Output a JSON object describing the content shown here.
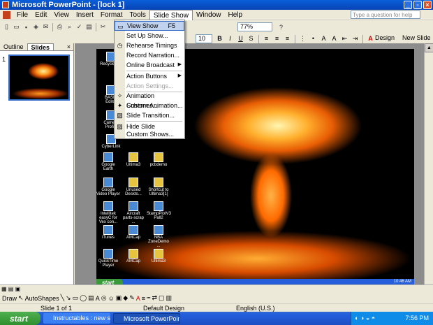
{
  "window": {
    "title": "Microsoft PowerPoint - [lock 1]"
  },
  "menubar": {
    "items": [
      "File",
      "Edit",
      "View",
      "Insert",
      "Format",
      "Tools",
      "Slide Show",
      "Window",
      "Help"
    ],
    "help_placeholder": "Type a question for help"
  },
  "toolbar": {
    "zoom": "77%",
    "font_size": "10",
    "design_label": "Design",
    "new_slide_label": "New Slide"
  },
  "slide_show_menu": {
    "items": [
      {
        "label": "View Show",
        "shortcut": "F5",
        "icon": "slideshow-icon",
        "state": "highlighted"
      },
      {
        "label": "Set Up Show...",
        "icon": "",
        "state": "normal"
      },
      {
        "label": "Rehearse Timings",
        "icon": "timer-icon",
        "state": "normal"
      },
      {
        "label": "Record Narration...",
        "icon": "",
        "state": "normal"
      },
      {
        "label": "Online Broadcast",
        "icon": "",
        "state": "submenu"
      },
      {
        "label": "Action Buttons",
        "icon": "",
        "state": "submenu"
      },
      {
        "label": "Action Settings...",
        "icon": "",
        "state": "disabled"
      },
      {
        "label": "Animation Schemes...",
        "icon": "animation-icon",
        "state": "normal"
      },
      {
        "label": "Custom Animation...",
        "icon": "custom-animation-icon",
        "state": "normal"
      },
      {
        "label": "Slide Transition...",
        "icon": "transition-icon",
        "state": "normal"
      },
      {
        "label": "Hide Slide",
        "icon": "hide-slide-icon",
        "state": "normal"
      },
      {
        "label": "Custom Shows...",
        "icon": "",
        "state": "normal"
      }
    ]
  },
  "left_pane": {
    "tabs": [
      "Outline",
      "Slides"
    ],
    "active_tab": "Slides",
    "slide_number": "1"
  },
  "slide_desktop_icons": [
    {
      "label": "Recycle Bin",
      "type": "app"
    },
    {
      "label": "BASIC Editor",
      "type": "app"
    },
    {
      "label": "Camera Profile",
      "type": "app"
    },
    {
      "label": "CyberLink",
      "type": "app"
    },
    {
      "label": "Google Earth",
      "type": "app"
    },
    {
      "label": "Ultima3",
      "type": "folder"
    },
    {
      "label": "pcbdemo",
      "type": "folder"
    },
    {
      "label": "Google Video Player",
      "type": "app"
    },
    {
      "label": "Unused Deskto...",
      "type": "folder"
    },
    {
      "label": "Shortcut to Ultima3[1]",
      "type": "folder"
    },
    {
      "label": "Intellitek easyC for Vex con...",
      "type": "app"
    },
    {
      "label": "Aircraft parts-scrap ...",
      "type": "app"
    },
    {
      "label": "StampPlotV3 Pall2",
      "type": "app"
    },
    {
      "label": "iTunes",
      "type": "app"
    },
    {
      "label": "AMCap",
      "type": "app"
    },
    {
      "label": "NBA ZoneDemo ...",
      "type": "app"
    },
    {
      "label": "QuickTime Player",
      "type": "app"
    },
    {
      "label": "AMCap",
      "type": "folder"
    },
    {
      "label": "Ultima3",
      "type": "folder"
    }
  ],
  "slide_taskbar": {
    "start": "start",
    "clock": "10:46 AM"
  },
  "drawbar": {
    "draw": "Draw",
    "autoshapes": "AutoShapes"
  },
  "statusbar": {
    "slide": "Slide 1 of 1",
    "design": "Default Design",
    "language": "English (U.S.)"
  },
  "taskbar": {
    "start": "start",
    "tasks": [
      "Instructables : new st...",
      "Microsoft PowerPoint ..."
    ],
    "clock": "7:56 PM"
  }
}
